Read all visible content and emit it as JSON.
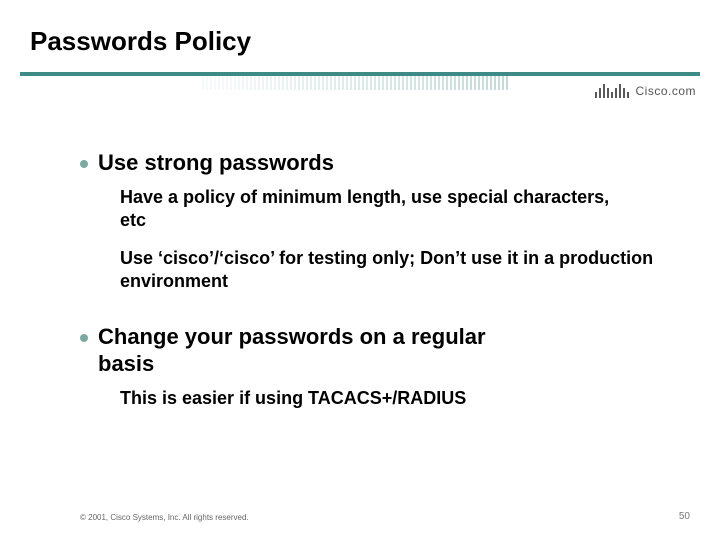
{
  "title": "Passwords Policy",
  "logo_text": "Cisco.com",
  "bullets": [
    {
      "text": "Use strong passwords",
      "subs": [
        "Have a policy of minimum length, use special characters, etc",
        "Use ‘cisco’/‘cisco’ for testing only; Don’t use it in a production environment"
      ]
    },
    {
      "text": "Change your passwords on a regular basis",
      "subs": [
        "This is easier if using TACACS+/RADIUS"
      ]
    }
  ],
  "copyright": "© 2001, Cisco Systems, Inc. All rights reserved.",
  "page_number": "50"
}
